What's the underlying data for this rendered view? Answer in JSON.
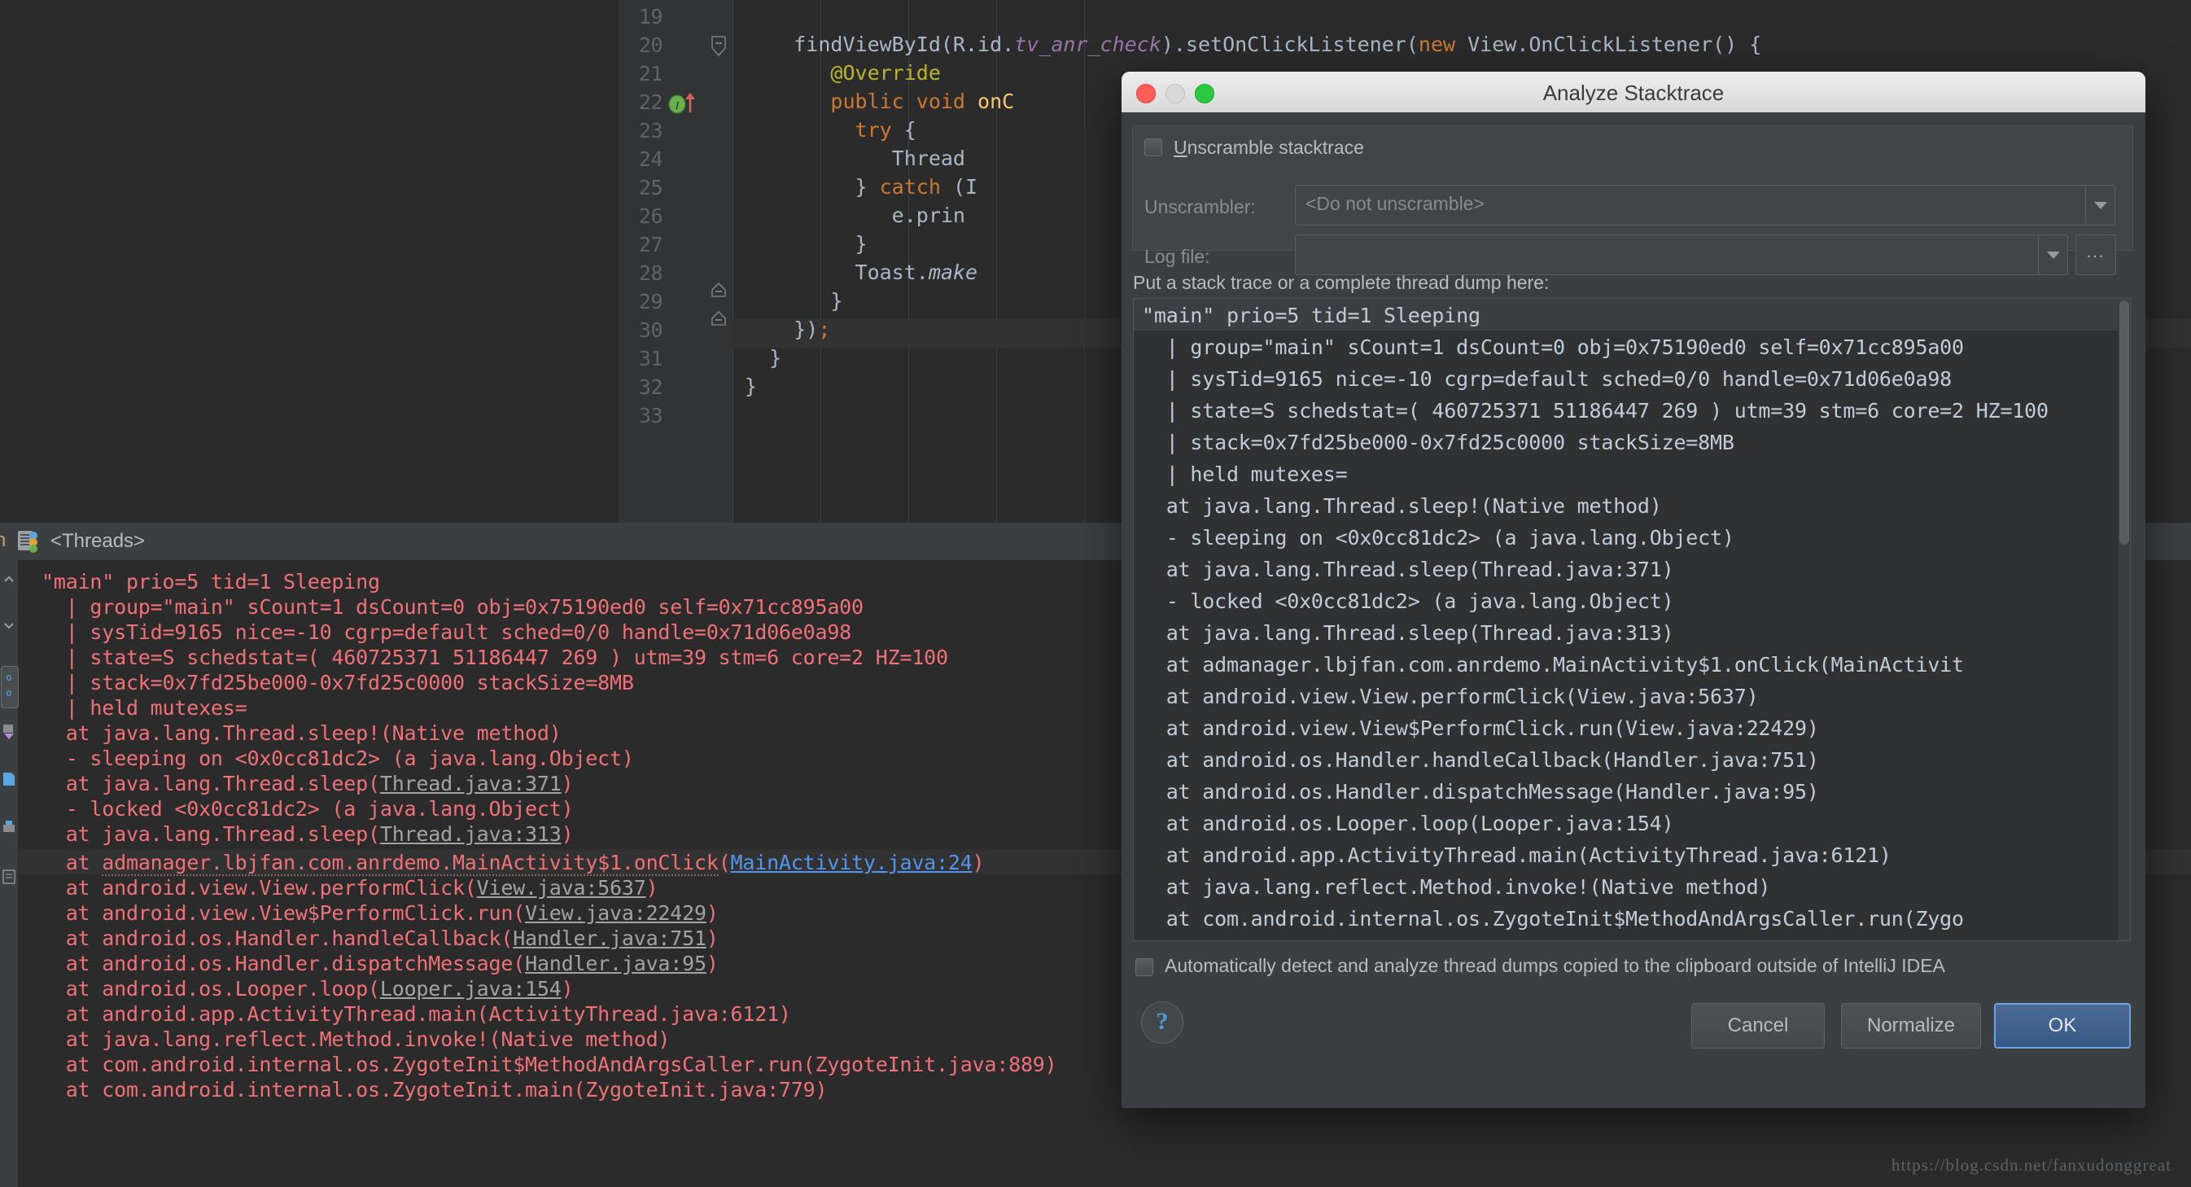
{
  "editor": {
    "gutter_lines": [
      "19",
      "20",
      "21",
      "22",
      "23",
      "24",
      "25",
      "26",
      "27",
      "28",
      "29",
      "30",
      "31",
      "32",
      "33"
    ],
    "code_lines": [
      {
        "num": "20",
        "text": "findViewById(R.id.tv_anr_check).setOnClickListener(new View.OnClickListener() {"
      },
      {
        "num": "21",
        "text": "@Override"
      },
      {
        "num": "22",
        "text": "public void onC"
      },
      {
        "num": "23",
        "text": "try {"
      },
      {
        "num": "24",
        "text": "Thread"
      },
      {
        "num": "25",
        "text": "} catch (I"
      },
      {
        "num": "26",
        "text": "e.prin"
      },
      {
        "num": "27",
        "text": "}"
      },
      {
        "num": "28",
        "text": "Toast.make"
      },
      {
        "num": "29",
        "text": "}"
      },
      {
        "num": "30",
        "text": "});"
      },
      {
        "num": "31",
        "text": "}"
      },
      {
        "num": "32",
        "text": "}"
      }
    ],
    "trailing_semicolon": ";"
  },
  "threads_panel": {
    "tab_prefix": "n",
    "tab_label": "<Threads>",
    "icon_name": "threads-icon",
    "lines": [
      "\"main\" prio=5 tid=1 Sleeping",
      "  | group=\"main\" sCount=1 dsCount=0 obj=0x75190ed0 self=0x71cc895a00",
      "  | sysTid=9165 nice=-10 cgrp=default sched=0/0 handle=0x71d06e0a98",
      "  | state=S schedstat=( 460725371 51186447 269 ) utm=39 stm=6 core=2 HZ=100",
      "  | stack=0x7fd25be000-0x7fd25c0000 stackSize=8MB",
      "  | held mutexes=",
      "  at java.lang.Thread.sleep!(Native method)",
      "  - sleeping on <0x0cc81dc2> (a java.lang.Object)",
      "  at java.lang.Thread.sleep(Thread.java:371)",
      "  - locked <0x0cc81dc2> (a java.lang.Object)",
      "  at java.lang.Thread.sleep(Thread.java:313)",
      "  at admanager.lbjfan.com.anrdemo.MainActivity$1.onClick(MainActivity.java:24)",
      "  at android.view.View.performClick(View.java:5637)",
      "  at android.view.View$PerformClick.run(View.java:22429)",
      "  at android.os.Handler.handleCallback(Handler.java:751)",
      "  at android.os.Handler.dispatchMessage(Handler.java:95)",
      "  at android.os.Looper.loop(Looper.java:154)",
      "  at android.app.ActivityThread.main(ActivityThread.java:6121)",
      "  at java.lang.reflect.Method.invoke!(Native method)",
      "  at com.android.internal.os.ZygoteInit$MethodAndArgsCaller.run(ZygoteInit.java:889)",
      "  at com.android.internal.os.ZygoteInit.main(ZygoteInit.java:779)"
    ],
    "links": [
      "Thread.java:371",
      "Thread.java:313",
      "View.java:5637",
      "View.java:22429",
      "Handler.java:751",
      "Handler.java:95",
      "Looper.java:154"
    ],
    "highlighted_link": "MainActivity.java:24",
    "link_color": "#a3a3a3",
    "highlighted_link_color": "#5394ec",
    "text_color": "#f07178"
  },
  "dialog": {
    "title": "Analyze Stacktrace",
    "window_controls": {
      "close": "close-button",
      "minimize": "minimize-button",
      "maximize": "maximize-button"
    },
    "unscramble_checkbox": {
      "label": "Unscramble stacktrace",
      "mnemonic": "U",
      "checked": false
    },
    "unscrambler": {
      "label": "Unscrambler:",
      "value": "<Do not unscramble>"
    },
    "logfile": {
      "label": "Log file:",
      "value": "",
      "browse_label": "..."
    },
    "textarea_caption": "Put a stack trace or a complete thread dump here:",
    "stacktrace_lines": [
      "\"main\" prio=5 tid=1 Sleeping",
      "  | group=\"main\" sCount=1 dsCount=0 obj=0x75190ed0 self=0x71cc895a00",
      "  | sysTid=9165 nice=-10 cgrp=default sched=0/0 handle=0x71d06e0a98",
      "  | state=S schedstat=( 460725371 51186447 269 ) utm=39 stm=6 core=2 HZ=100",
      "  | stack=0x7fd25be000-0x7fd25c0000 stackSize=8MB",
      "  | held mutexes=",
      "  at java.lang.Thread.sleep!(Native method)",
      "  - sleeping on <0x0cc81dc2> (a java.lang.Object)",
      "  at java.lang.Thread.sleep(Thread.java:371)",
      "  - locked <0x0cc81dc2> (a java.lang.Object)",
      "  at java.lang.Thread.sleep(Thread.java:313)",
      "  at admanager.lbjfan.com.anrdemo.MainActivity$1.onClick(MainActivit",
      "  at android.view.View.performClick(View.java:5637)",
      "  at android.view.View$PerformClick.run(View.java:22429)",
      "  at android.os.Handler.handleCallback(Handler.java:751)",
      "  at android.os.Handler.dispatchMessage(Handler.java:95)",
      "  at android.os.Looper.loop(Looper.java:154)",
      "  at android.app.ActivityThread.main(ActivityThread.java:6121)",
      "  at java.lang.reflect.Method.invoke!(Native method)",
      "  at com.android.internal.os.ZygoteInit$MethodAndArgsCaller.run(Zygo"
    ],
    "auto_detect_checkbox": {
      "label": "Automatically detect and analyze thread dumps copied to the clipboard outside of IntelliJ IDEA",
      "checked": false
    },
    "help_label": "?",
    "buttons": {
      "cancel": "Cancel",
      "normalize": "Normalize",
      "ok": "OK"
    },
    "accent_color": "#6ea4e0"
  },
  "watermark": "https://blog.csdn.net/fanxudonggreat"
}
